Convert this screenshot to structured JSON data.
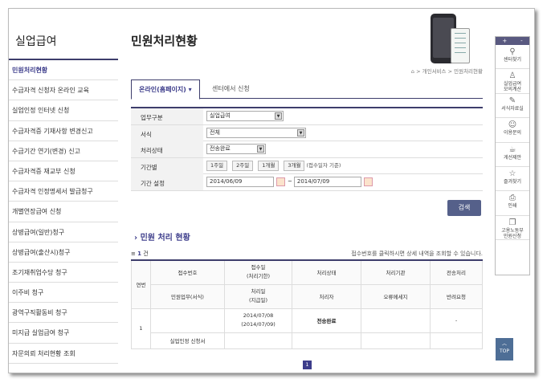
{
  "sidebar": {
    "title": "실업급여",
    "items": [
      {
        "label": "민원처리현황",
        "active": true
      },
      {
        "label": "수급자격 신청자 온라인 교육"
      },
      {
        "label": "실업인정 인터넷 신청"
      },
      {
        "label": "수급자격증 기재사항 변경신고"
      },
      {
        "label": "수급기간 연기(변경) 신고"
      },
      {
        "label": "수급자격증 재교부 신청"
      },
      {
        "label": "수급자격 인정명세서 발급청구"
      },
      {
        "label": "개별연장급여 신청"
      },
      {
        "label": "상병급여(일반)청구"
      },
      {
        "label": "상병급여(출산시)청구"
      },
      {
        "label": "조기재취업수당 청구"
      },
      {
        "label": "이주비 청구"
      },
      {
        "label": "광역구직활동비 청구"
      },
      {
        "label": "미지급 실업급여 청구"
      },
      {
        "label": "자문의뢰 처리현황 조회"
      }
    ]
  },
  "page": {
    "title": "민원처리현황",
    "breadcrumb": "⌂ > 개인서비스 > 민원처리현황"
  },
  "tabs": [
    {
      "label": "온라인(홈페이지) ▾",
      "active": true
    },
    {
      "label": "센터에서 신청",
      "active": false
    }
  ],
  "form": {
    "type_label": "업무구분",
    "type_value": "실업급여",
    "form_label": "서식",
    "form_value": "전체",
    "status_label": "처리상태",
    "status_value": "전송완료",
    "period_label": "기간별",
    "period_buttons": [
      "1주일",
      "2주일",
      "1개월",
      "3개월"
    ],
    "period_hint": "(접수일자 기준)",
    "range_label": "기간 설정",
    "date_from": "2014/06/09",
    "date_to": "2014/07/09",
    "tilde": "~",
    "search_label": "검색"
  },
  "results": {
    "section_title": "› 민원 처리 현황",
    "count_icon": "≡",
    "count": "1",
    "count_unit": "건",
    "note": "접수번호를 클릭하시면 상세 내역을 조회할 수 있습니다.",
    "headers": {
      "no": "연번",
      "receipt_no": "접수번호",
      "receipt_date": "접수일\n(처리기한)",
      "status": "처리상태",
      "agency": "처리기관",
      "transfer": "전송처리",
      "task": "민원업무(서식)",
      "process_date": "처리일\n(지급일)",
      "handler": "처리자",
      "error": "오류메세지",
      "return": "반려요청"
    },
    "rows": [
      {
        "no": "1",
        "receipt_no": "",
        "receipt_date": "2014/07/08\n(2014/07/09)",
        "status": "전송완료",
        "agency": "",
        "transfer": "-",
        "task": "실업인정 신청서",
        "process_date": "",
        "handler": "",
        "error": "",
        "return": ""
      }
    ],
    "page": "1"
  },
  "quickbar": {
    "top_plus": "+",
    "top_minus": "-",
    "items": [
      {
        "icon": "location-pin-icon",
        "glyph": "⚲",
        "label": "센터찾기"
      },
      {
        "icon": "person-icon",
        "glyph": "♙",
        "label": "실업급여\n모의계산"
      },
      {
        "icon": "edit-icon",
        "glyph": "✎",
        "label": "서식자료실"
      },
      {
        "icon": "chat-icon",
        "glyph": "☺",
        "label": "이용문의"
      },
      {
        "icon": "coffee-icon",
        "glyph": "☕",
        "label": "게선제안"
      },
      {
        "icon": "star-icon",
        "glyph": "☆",
        "label": "즐겨찾기"
      },
      {
        "icon": "print-icon",
        "glyph": "⎙",
        "label": "인쇄"
      },
      {
        "icon": "copy-icon",
        "glyph": "❐",
        "label": "고용노동부\n민원신청"
      }
    ],
    "top_label": "TOP"
  }
}
